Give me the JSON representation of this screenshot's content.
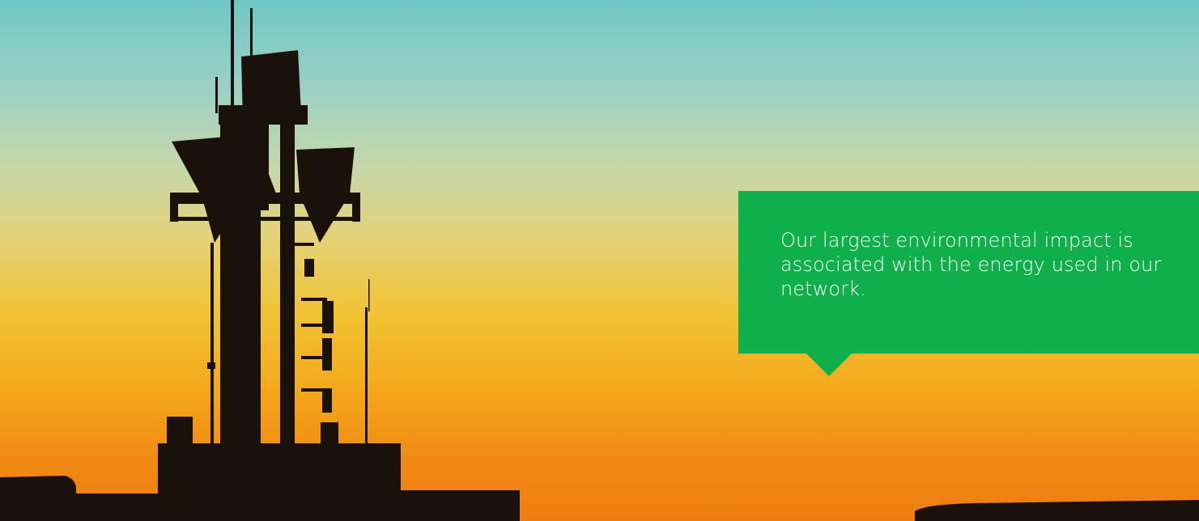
{
  "hero": {
    "photo_subject": "telecom-tower-silhouette-at-sunset"
  },
  "callout": {
    "text": "Our largest environmental impact is associated with the energy used in our network.",
    "background_color": "#0faf4b",
    "text_color": "#ffffff"
  }
}
